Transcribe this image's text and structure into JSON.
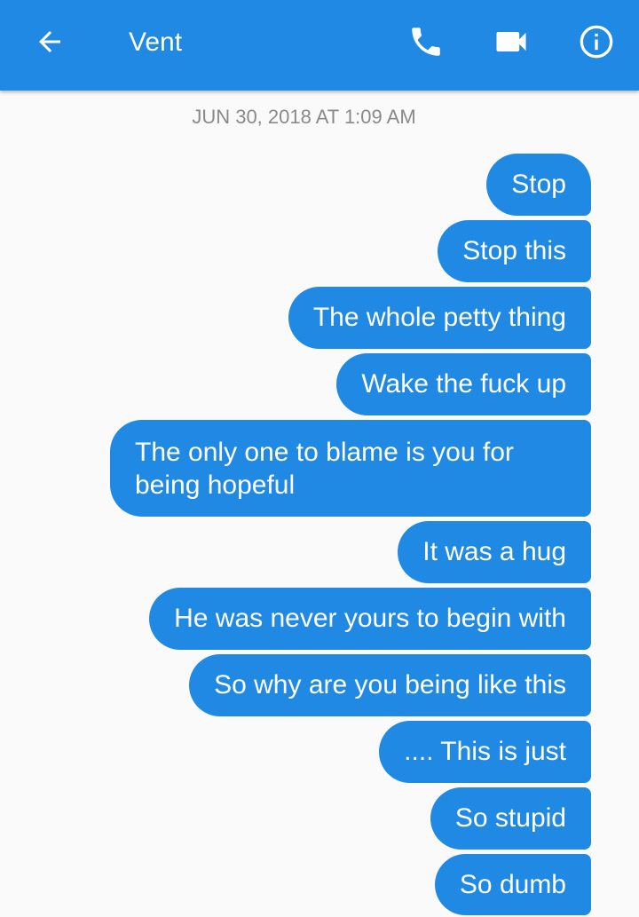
{
  "header": {
    "title": "Vent",
    "icons": {
      "back": "arrow-back-icon",
      "call": "phone-icon",
      "video": "video-camera-icon",
      "info": "info-icon"
    }
  },
  "timestamp": "JUN 30, 2018 AT 1:09 AM",
  "messages": [
    "Stop",
    "Stop this",
    "The whole petty thing",
    "Wake the fuck up",
    "The only one to blame is you for being hopeful",
    "It was a hug",
    "He was never yours to begin with",
    "So why are you being like this",
    ".... This is just",
    "So stupid",
    "So dumb"
  ],
  "colors": {
    "accent": "#2089e3",
    "background": "#fafafa",
    "timestamp_text": "#8a8a8a",
    "bubble_text": "#ffffff"
  }
}
